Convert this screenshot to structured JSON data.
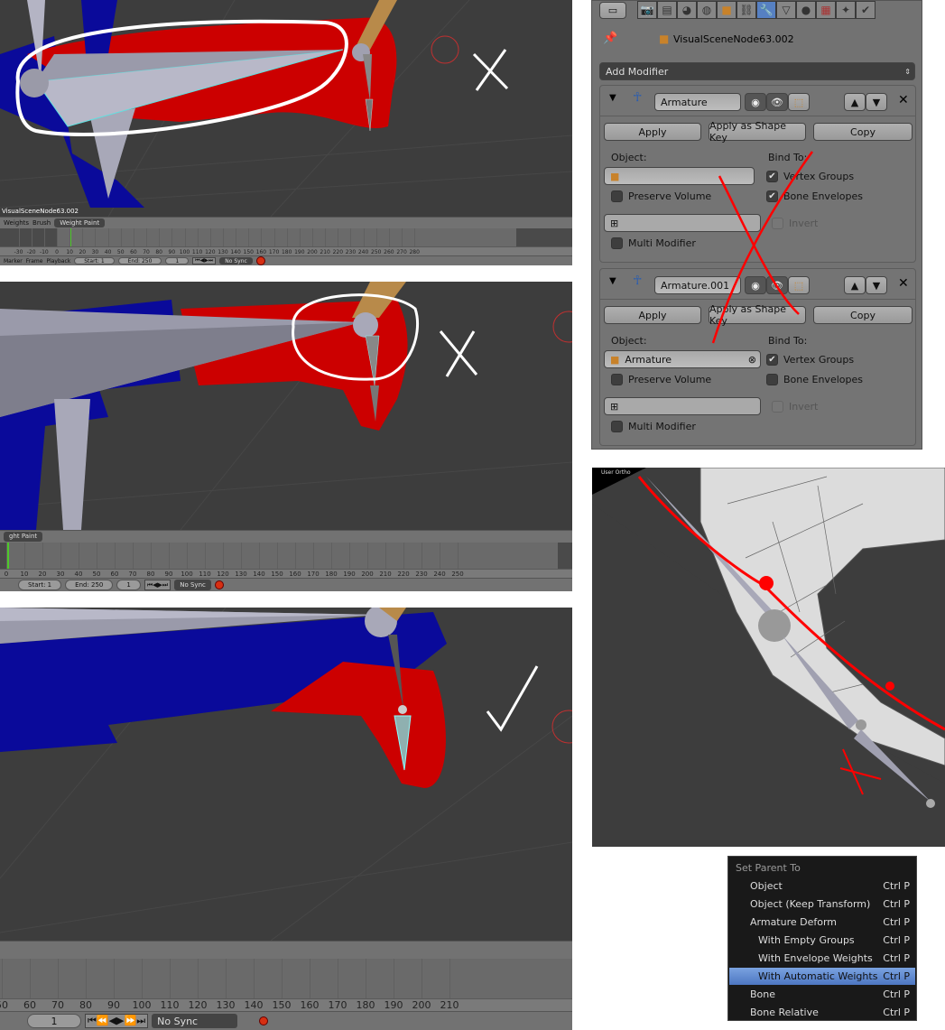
{
  "panel1": {
    "object_label": "VisualSceneNode63.002",
    "header": {
      "menus": [
        "Weights",
        "Brush"
      ],
      "mode": "Weight Paint"
    },
    "ruler": [
      -30,
      -20,
      -10,
      0,
      10,
      20,
      30,
      40,
      50,
      60,
      70,
      80,
      90,
      100,
      110,
      120,
      130,
      140,
      150,
      160,
      170,
      180,
      190,
      200,
      210,
      220,
      230,
      240,
      250,
      260,
      270,
      280
    ],
    "bottom": {
      "menus": [
        "Marker",
        "Frame",
        "Playback"
      ],
      "start": "Start: 1",
      "end": "End: 250",
      "frame": "1",
      "sync": "No Sync"
    }
  },
  "panel2": {
    "header": {
      "mode": "ght Paint"
    },
    "ruler": [
      0,
      10,
      20,
      30,
      40,
      50,
      60,
      70,
      80,
      90,
      100,
      110,
      120,
      130,
      140,
      150,
      160,
      170,
      180,
      190,
      200,
      210,
      220,
      230,
      240,
      250
    ],
    "bottom": {
      "start": "Start: 1",
      "end": "End: 250",
      "frame": "1",
      "sync": "No Sync"
    }
  },
  "panel3": {
    "ruler": [
      50,
      60,
      70,
      80,
      90,
      100,
      110,
      120,
      130,
      140,
      150,
      160,
      170,
      180,
      190,
      200,
      210
    ],
    "bottom": {
      "frame": "1",
      "sync": "No Sync"
    }
  },
  "properties": {
    "tabs": [
      "render",
      "render-layers",
      "scene",
      "world",
      "object",
      "constraints",
      "modifiers",
      "data",
      "material",
      "texture",
      "particles",
      "physics"
    ],
    "active_tab": "modifiers",
    "breadcrumb": "VisualSceneNode63.002",
    "add_modifier": "Add Modifier",
    "modifiers": [
      {
        "name": "Armature",
        "apply": "Apply",
        "apply_shape": "Apply as Shape Key",
        "copy": "Copy",
        "object_label": "Object:",
        "object_value": "",
        "bind_to": "Bind To:",
        "vertex_groups": "Vertex Groups",
        "vertex_groups_checked": true,
        "bone_envelopes": "Bone Envelopes",
        "bone_envelopes_checked": true,
        "preserve_volume": "Preserve Volume",
        "invert": "Invert",
        "multi_modifier": "Multi Modifier"
      },
      {
        "name": "Armature.001",
        "apply": "Apply",
        "apply_shape": "Apply as Shape Key",
        "copy": "Copy",
        "object_label": "Object:",
        "object_value": "Armature",
        "bind_to": "Bind To:",
        "vertex_groups": "Vertex Groups",
        "vertex_groups_checked": true,
        "bone_envelopes": "Bone Envelopes",
        "bone_envelopes_checked": false,
        "preserve_volume": "Preserve Volume",
        "invert": "Invert",
        "multi_modifier": "Multi Modifier"
      }
    ]
  },
  "viewport4": {
    "view_label": "User Ortho"
  },
  "menu": {
    "title": "Set Parent To",
    "items": [
      {
        "label": "Object",
        "shortcut": "Ctrl P",
        "indent": false,
        "highlighted": false
      },
      {
        "label": "Object (Keep Transform)",
        "shortcut": "Ctrl P",
        "indent": false,
        "highlighted": false
      },
      {
        "label": "Armature Deform",
        "shortcut": "Ctrl P",
        "indent": false,
        "highlighted": false
      },
      {
        "label": "With Empty Groups",
        "shortcut": "Ctrl P",
        "indent": true,
        "highlighted": false
      },
      {
        "label": "With Envelope Weights",
        "shortcut": "Ctrl P",
        "indent": true,
        "highlighted": false
      },
      {
        "label": "With Automatic Weights",
        "shortcut": "Ctrl P",
        "indent": true,
        "highlighted": true
      },
      {
        "label": "Bone",
        "shortcut": "Ctrl P",
        "indent": false,
        "highlighted": false
      },
      {
        "label": "Bone Relative",
        "shortcut": "Ctrl P",
        "indent": false,
        "highlighted": false
      }
    ]
  },
  "colors": {
    "viewport": "#3d3d3d",
    "panel": "#727272",
    "accent": "#5680c2",
    "weight_red": "#cc0000",
    "weight_blue": "#0a0a9a",
    "annotation_red": "#ff0000"
  }
}
